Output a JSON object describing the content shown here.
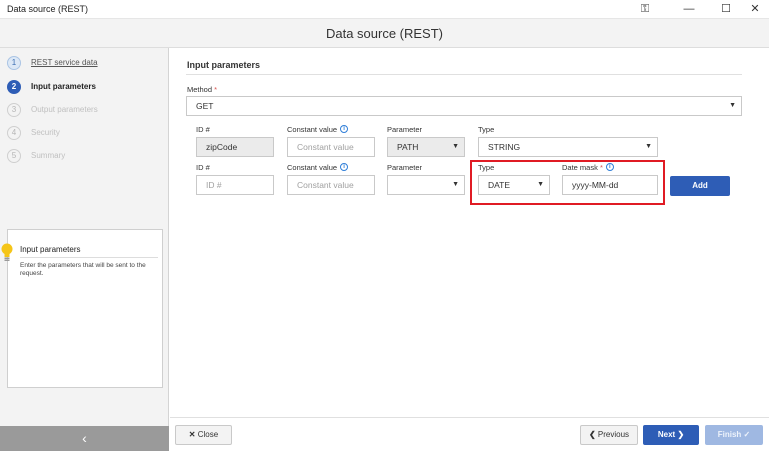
{
  "window": {
    "title": "Data source (REST)",
    "controls": {
      "key": "⚿",
      "minimize": "—",
      "maximize": "☐",
      "close": "✕"
    }
  },
  "header": {
    "title": "Data source (REST)"
  },
  "steps": [
    {
      "num": "1",
      "label": "REST service data",
      "state": "done"
    },
    {
      "num": "2",
      "label": "Input parameters",
      "state": "active"
    },
    {
      "num": "3",
      "label": "Output parameters",
      "state": "off"
    },
    {
      "num": "4",
      "label": "Security",
      "state": "off"
    },
    {
      "num": "5",
      "label": "Summary",
      "state": "off"
    }
  ],
  "help": {
    "title": "Input parameters",
    "text": "Enter the parameters that will be sent to the request."
  },
  "sidebar": {
    "collapse_glyph": "‹"
  },
  "section": {
    "title": "Input parameters"
  },
  "method": {
    "label": "Method",
    "required_mark": "*",
    "value": "GET"
  },
  "row1": {
    "id_label": "ID #",
    "id_value": "zipCode",
    "const_label": "Constant value",
    "const_placeholder": "Constant value",
    "param_label": "Parameter",
    "param_value": "PATH",
    "type_label": "Type",
    "type_value": "STRING"
  },
  "row2": {
    "id_label": "ID #",
    "id_placeholder": "ID #",
    "const_label": "Constant value",
    "const_placeholder": "Constant value",
    "param_label": "Parameter",
    "param_value": "",
    "type_label": "Type",
    "type_value": "DATE",
    "mask_label": "Date mask",
    "mask_required": "*",
    "mask_value": "yyyy-MM-dd",
    "add_label": "Add"
  },
  "info_glyph": "i",
  "caret_glyph": "▼",
  "footer": {
    "close_label": "Close",
    "close_icon": "✕",
    "previous_label": "Previous",
    "previous_icon": "❮",
    "next_label": "Next",
    "next_icon": "❯",
    "finish_label": "Finish",
    "finish_icon": "✓"
  },
  "colors": {
    "accent": "#2e5db6",
    "highlight": "#e01b24",
    "required": "#d9534f",
    "info": "#2f7ed8"
  }
}
